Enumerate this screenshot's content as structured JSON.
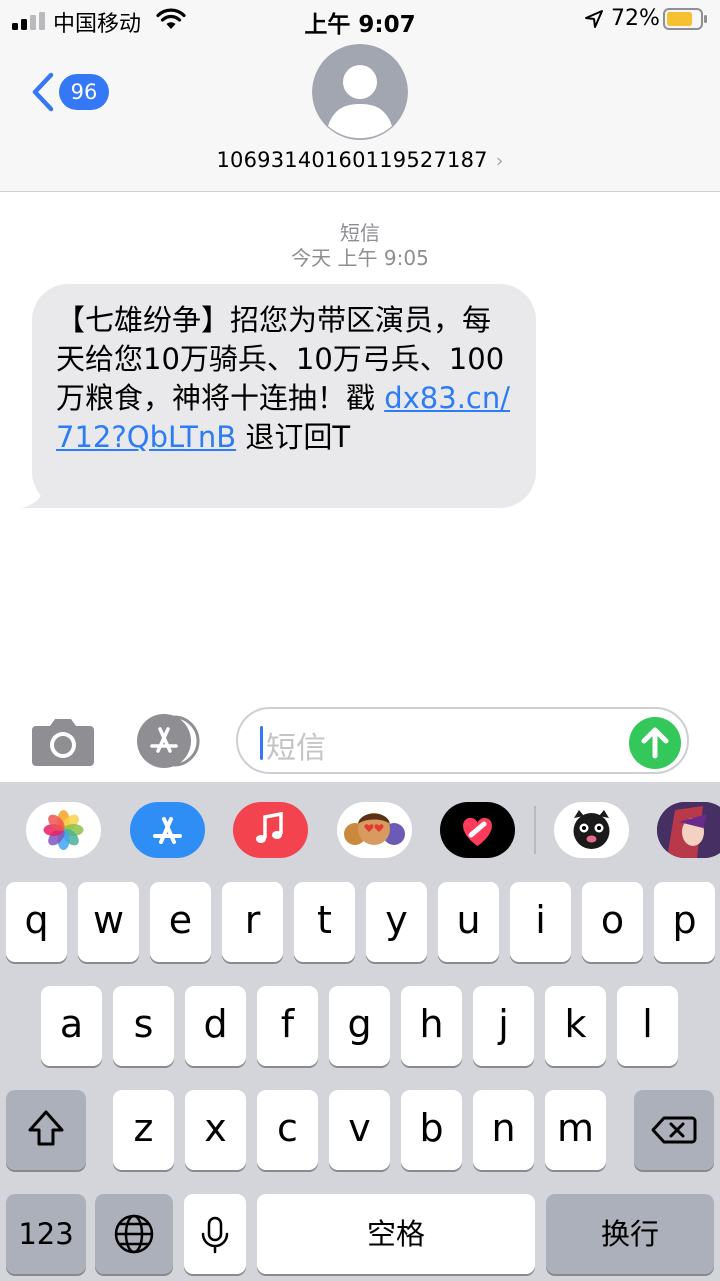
{
  "status_bar": {
    "carrier": "中国移动",
    "time": "上午 9:07",
    "battery_percent": "72%",
    "battery_level": 0.72,
    "icons": [
      "signal-icon",
      "wifi-icon",
      "location-arrow-icon",
      "battery-icon"
    ]
  },
  "header": {
    "back_count": "96",
    "contact_number": "10693140160119527187",
    "contact_chevron": "›"
  },
  "conversation": {
    "service_label": "短信",
    "timestamp": "今天 上午 9:05",
    "message": {
      "text_before_link": "【七雄纷争】招您为带区演员，每天给您10万骑兵、10万弓兵、100万粮食，神将十连抽！戳 ",
      "link": "dx83.cn/712?QbLTnB",
      "text_after_link": " 退订回T"
    }
  },
  "input_bar": {
    "placeholder": "短信",
    "icons": [
      "camera-icon",
      "app-store-icon",
      "send-arrow-icon"
    ]
  },
  "app_drawer": {
    "apps": [
      "photos-icon",
      "app-store-icon",
      "music-icon",
      "memoji-icon",
      "digital-touch-icon",
      "animoji-icon",
      "sticker-app-icon"
    ]
  },
  "keyboard": {
    "row1": [
      "q",
      "w",
      "e",
      "r",
      "t",
      "y",
      "u",
      "i",
      "o",
      "p"
    ],
    "row2": [
      "a",
      "s",
      "d",
      "f",
      "g",
      "h",
      "j",
      "k",
      "l"
    ],
    "row3": [
      "z",
      "x",
      "c",
      "v",
      "b",
      "n",
      "m"
    ],
    "numbers_label": "123",
    "space_label": "空格",
    "return_label": "换行",
    "icons": [
      "shift-icon",
      "delete-icon",
      "globe-icon",
      "microphone-icon"
    ]
  },
  "colors": {
    "accent": "#3478f6",
    "send": "#34c759",
    "bubble": "#e9e9eb",
    "link": "#2b7cf6"
  }
}
